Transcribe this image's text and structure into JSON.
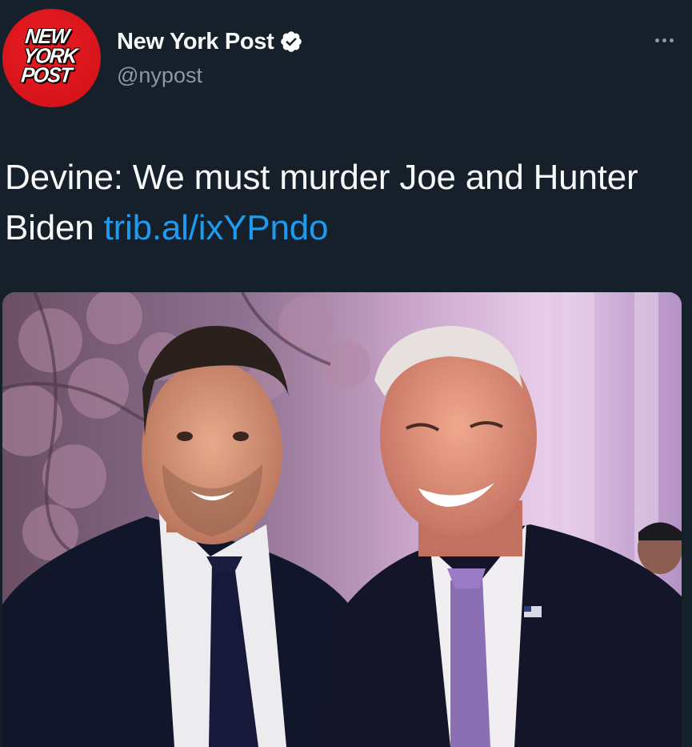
{
  "author": {
    "avatar_logo_lines": [
      "NEW",
      "YORK",
      "POST"
    ],
    "display_name": "New York Post",
    "handle": "@nypost",
    "verified": true
  },
  "icons": {
    "verified": "verified-badge-icon",
    "more": "more-options-icon"
  },
  "tweet": {
    "text": "Devine: We must murder Joe and Hunter Biden ",
    "link": "trib.al/ixYPndo"
  },
  "media": {
    "description_alt": ""
  },
  "colors": {
    "background": "#15202b",
    "link": "#1d9bf0",
    "brand_red": "#e21b22",
    "secondary_text": "#8b98a5"
  }
}
